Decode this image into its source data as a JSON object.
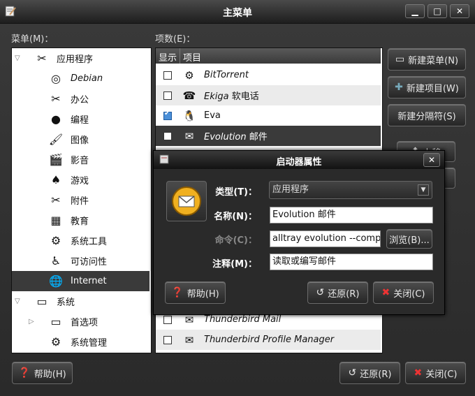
{
  "window": {
    "title": "主菜单",
    "minimize": "▁",
    "maximize": "□",
    "close": "✕"
  },
  "left_label": "菜单(M)：",
  "right_label": "项数(E)：",
  "tree": [
    {
      "label": "应用程序",
      "icon": "applications-icon",
      "glyph": "✂",
      "expanded": true
    },
    {
      "label": "Debian",
      "icon": "debian-icon",
      "glyph": "◎"
    },
    {
      "label": "办公",
      "icon": "office-icon",
      "glyph": "✂"
    },
    {
      "label": "编程",
      "icon": "programming-icon",
      "glyph": "●"
    },
    {
      "label": "图像",
      "icon": "graphics-icon",
      "glyph": "🖌"
    },
    {
      "label": "影音",
      "icon": "multimedia-icon",
      "glyph": "🎬"
    },
    {
      "label": "游戏",
      "icon": "games-icon",
      "glyph": "♠"
    },
    {
      "label": "附件",
      "icon": "accessories-icon",
      "glyph": "✂"
    },
    {
      "label": "教育",
      "icon": "education-icon",
      "glyph": "▦"
    },
    {
      "label": "系统工具",
      "icon": "system-tools-icon",
      "glyph": "⚙"
    },
    {
      "label": "可访问性",
      "icon": "accessibility-icon",
      "glyph": "♿"
    },
    {
      "label": "Internet",
      "icon": "internet-icon",
      "glyph": "🌐",
      "selected": true
    },
    {
      "label": "系统",
      "icon": "system-icon",
      "glyph": "▭",
      "expanded": true
    },
    {
      "label": "首选项",
      "icon": "preferences-icon",
      "glyph": "▭",
      "collapsed": true
    },
    {
      "label": "系统管理",
      "icon": "administration-icon",
      "glyph": "⚙"
    }
  ],
  "list": {
    "col_show": "显示",
    "col_item": "项目",
    "rows": [
      {
        "label": "BitTorrent",
        "checked": false,
        "italic": true,
        "icon": "bittorrent-icon",
        "glyph": "⚙"
      },
      {
        "label": "Ekiga 软电话",
        "checked": false,
        "italic_prefix": "Ekiga",
        "suffix": " 软电话",
        "icon": "ekiga-icon",
        "glyph": "☎"
      },
      {
        "label": "Eva",
        "checked": true,
        "italic": false,
        "icon": "eva-penguin-icon",
        "glyph": "🐧"
      },
      {
        "label": "Evolution 邮件",
        "checked": false,
        "italic_prefix": "Evolution",
        "suffix": " 邮件",
        "icon": "evolution-icon",
        "glyph": "✉",
        "selected": true
      },
      {
        "label": "Thunderbird Mail",
        "checked": false,
        "italic": true,
        "icon": "thunderbird-icon",
        "glyph": "✉"
      },
      {
        "label": "Thunderbird Profile Manager",
        "checked": false,
        "italic": true,
        "icon": "thunderbird-profile-icon",
        "glyph": "✉"
      }
    ]
  },
  "side_buttons": {
    "new_menu": "新建菜单(N)",
    "new_item": "新建项目(W)",
    "new_separator": "新建分隔符(S)",
    "move_up": "上移"
  },
  "bottom": {
    "help": "帮助(H)",
    "revert": "还原(R)",
    "close": "关闭(C)"
  },
  "dialog": {
    "title": "启动器属性",
    "type_label": "类型(T)：",
    "type_value": "应用程序",
    "name_label": "名称(N)：",
    "name_value": "Evolution 邮件",
    "command_label": "命令(C)：",
    "command_value": "alltray evolution --comp",
    "browse": "浏览(B)...",
    "comment_label": "注释(M)：",
    "comment_value": "读取或编写邮件",
    "help": "帮助(H)",
    "revert": "还原(R)",
    "close": "关闭(C)"
  }
}
